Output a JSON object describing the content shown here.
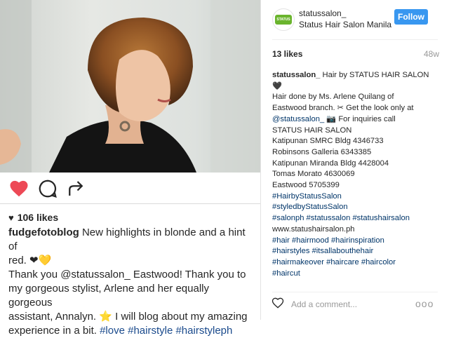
{
  "left_panel": {
    "likes": "106 likes",
    "caption": {
      "username": "fudgefotoblog",
      "line1": " New highlights in blonde and a hint of",
      "line2": "red. ",
      "line2_emoji": "❤💛",
      "line3": "Thank you @statussalon_ Eastwood! Thank you to",
      "line4": "my gorgeous stylist, Arlene and her equally gorgeous",
      "line5_a": "assistant, Annalyn. ",
      "line5_star": "⭐",
      "line5_b": " I will blog about my amazing",
      "line6_a": "experience in a bit. ",
      "line6_tags": "#love #hairstyle #hairstyleph"
    }
  },
  "right_panel": {
    "header": {
      "username": "statussalon_",
      "location": "Status Hair Salon Manila",
      "follow_label": "Follow",
      "avatar_text": "STATUS HAIR"
    },
    "likes": "13 likes",
    "time": "48w",
    "caption_lines": [
      {
        "user": "statussalon_",
        "text": " Hair by STATUS HAIR SALON"
      },
      {
        "text": "🖤"
      },
      {
        "text": "Hair done by Ms. Arlene Quilang of"
      },
      {
        "text": "Eastwood branch. ✂ Get the look only at"
      },
      {
        "tag": "@statussalon_",
        "text": " 📷 For inquiries call"
      },
      {
        "text": "STATUS HAIR SALON"
      },
      {
        "text": "Katipunan SMRC Bldg 4346733"
      },
      {
        "text": "Robinsons Galleria 6343385"
      },
      {
        "text": "Katipunan Miranda Bldg 4428004"
      },
      {
        "text": "Tomas Morato 4630069"
      },
      {
        "text": "Eastwood 5705399"
      },
      {
        "tag": "#HairbyStatusSalon"
      },
      {
        "tag": "#styledbyStatusSalon"
      },
      {
        "tag": "#salonph #statussalon #statushairsalon"
      },
      {
        "text": "www.statushairsalon.ph"
      },
      {
        "tag": "#hair #hairmood #hairinspiration"
      },
      {
        "tag": "#hairstyles #itsallabouthehair"
      },
      {
        "tag": "#hairmakeover #haircare #haircolor"
      },
      {
        "tag": "#haircut"
      }
    ],
    "add_comment_placeholder": "Add a comment...",
    "more_label": "ooo"
  },
  "icons": {
    "like": "heart-icon",
    "comment": "comment-icon",
    "share": "share-icon",
    "more": "more-icon"
  },
  "colors": {
    "like_red": "#ed4956",
    "follow_blue": "#3897f0",
    "hashtag_blue": "#003569",
    "brand_green": "#6ab42d"
  }
}
